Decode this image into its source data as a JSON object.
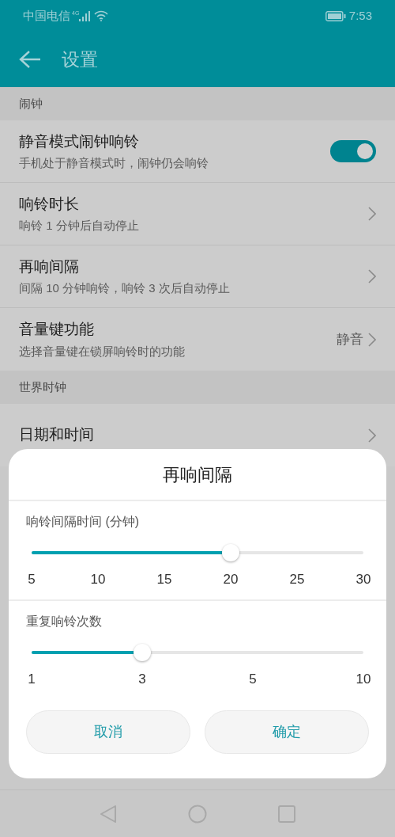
{
  "status_bar": {
    "carrier": "中国电信",
    "network": "4G",
    "time": "7:53"
  },
  "toolbar": {
    "title": "设置"
  },
  "sections": [
    {
      "header": "闹钟",
      "items": [
        {
          "kind": "switch",
          "title": "静音模式闹钟响铃",
          "subtitle": "手机处于静音模式时，闹钟仍会响铃",
          "on": true
        },
        {
          "kind": "link",
          "title": "响铃时长",
          "subtitle": "响铃 1 分钟后自动停止"
        },
        {
          "kind": "link",
          "title": "再响间隔",
          "subtitle": "间隔 10 分钟响铃，响铃 3 次后自动停止"
        },
        {
          "kind": "link",
          "title": "音量键功能",
          "subtitle": "选择音量键在锁屏响铃时的功能",
          "value": "静音"
        }
      ]
    },
    {
      "header": "世界时钟",
      "items": [
        {
          "kind": "link",
          "title": "日期和时间"
        }
      ]
    }
  ],
  "dialog": {
    "title": "再响间隔",
    "sliders": [
      {
        "label": "响铃间隔时间 (分钟)",
        "level": 0.6,
        "ticks": [
          "5",
          "10",
          "15",
          "20",
          "25",
          "30"
        ]
      },
      {
        "label": "重复响铃次数",
        "level": 0.3333,
        "ticks": [
          "1",
          "3",
          "5",
          "10"
        ]
      }
    ],
    "buttons": [
      "取消",
      "确定"
    ]
  }
}
